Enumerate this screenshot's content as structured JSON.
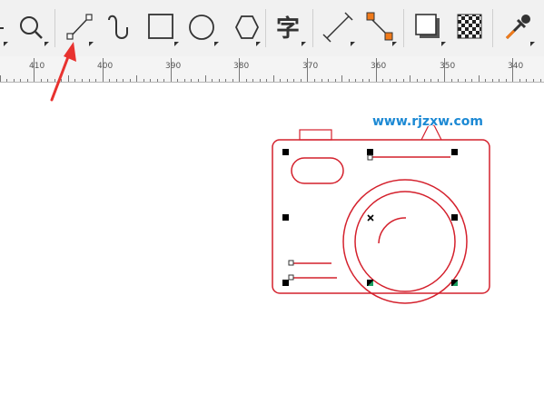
{
  "toolbar": {
    "tools": [
      {
        "id": "pick",
        "icon": "pick-tool-icon"
      },
      {
        "id": "zoom",
        "icon": "zoom-icon"
      },
      {
        "id": "two-point-line",
        "icon": "two-point-line-icon",
        "highlighted": true
      },
      {
        "id": "bezier",
        "icon": "bezier-curve-icon"
      },
      {
        "id": "rectangle",
        "icon": "rectangle-icon"
      },
      {
        "id": "ellipse",
        "icon": "ellipse-icon"
      },
      {
        "id": "polygon",
        "icon": "polygon-icon"
      },
      {
        "id": "text",
        "icon": "text-icon",
        "glyph": "字"
      },
      {
        "id": "parallel-dimension",
        "icon": "dimension-icon"
      },
      {
        "id": "connector",
        "icon": "connector-icon"
      },
      {
        "id": "drop-shadow",
        "icon": "drop-shadow-icon"
      },
      {
        "id": "transparency",
        "icon": "transparency-icon"
      },
      {
        "id": "eyedropper",
        "icon": "eyedropper-icon"
      }
    ]
  },
  "ruler": {
    "labels": [
      "410",
      "400",
      "390",
      "380",
      "370",
      "360",
      "350",
      "340"
    ]
  },
  "watermark": "www.rjzxw.com",
  "colors": {
    "drawing": "#d4202c",
    "accent_orange": "#f07a1a",
    "arrow": "#e8322f",
    "watermark": "#1c89d4",
    "node_green": "#1aa060"
  }
}
